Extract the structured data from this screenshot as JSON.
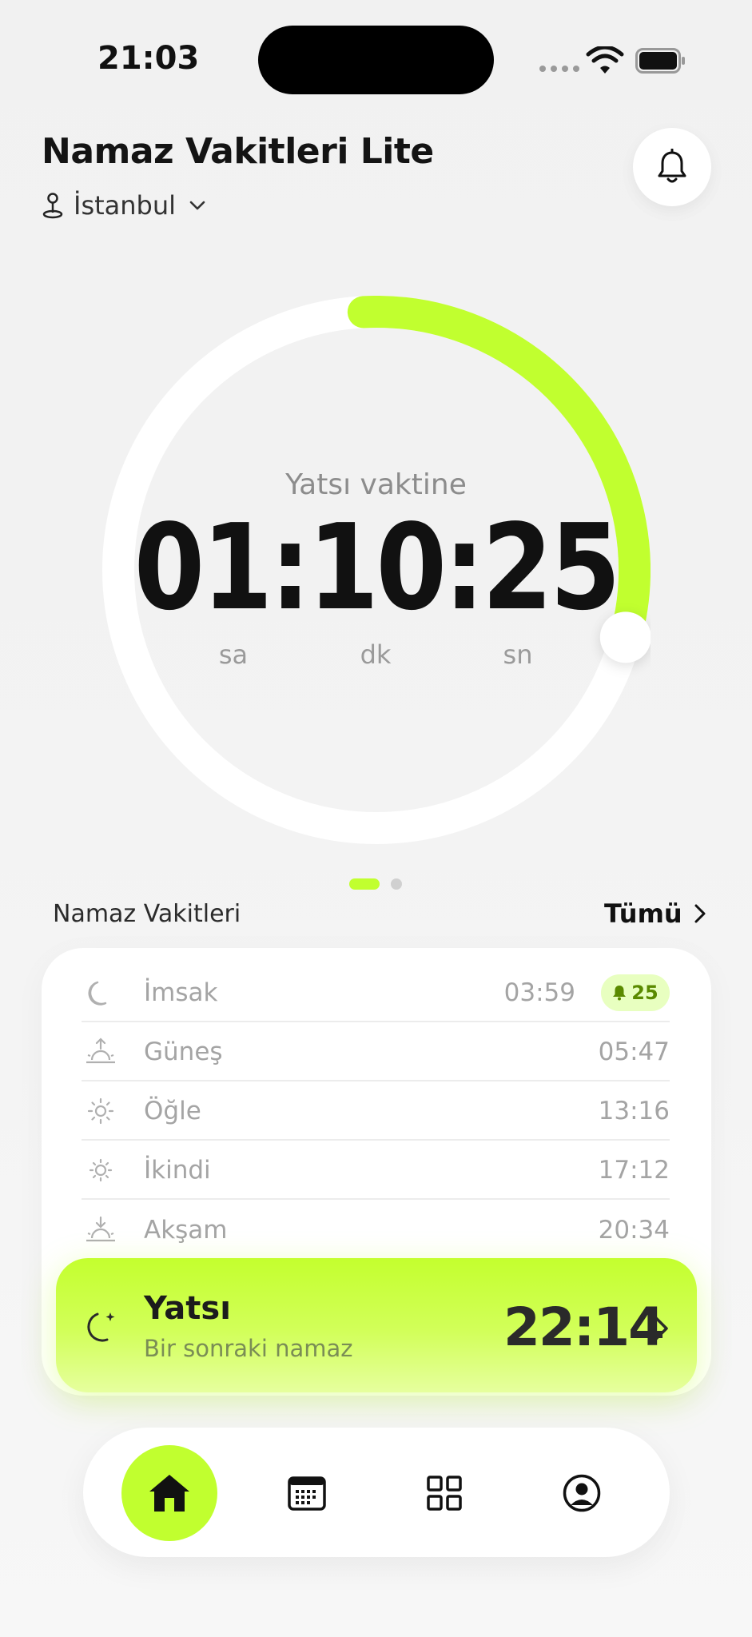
{
  "status": {
    "time": "21:03"
  },
  "header": {
    "title": "Namaz Vakitleri Lite",
    "location": "İstanbul"
  },
  "countdown": {
    "label": "Yatsı vaktine",
    "value": "01:10:25",
    "units": {
      "hours": "sa",
      "minutes": "dk",
      "seconds": "sn"
    },
    "progress": 0.3
  },
  "section": {
    "title": "Namaz Vakitleri",
    "see_all": "Tümü"
  },
  "prayers": [
    {
      "name": "İmsak",
      "time": "03:59",
      "icon": "moon-icon",
      "alarm": "25"
    },
    {
      "name": "Güneş",
      "time": "05:47",
      "icon": "sunrise-icon"
    },
    {
      "name": "Öğle",
      "time": "13:16",
      "icon": "sun-icon"
    },
    {
      "name": "İkindi",
      "time": "17:12",
      "icon": "sun-small-icon"
    },
    {
      "name": "Akşam",
      "time": "20:34",
      "icon": "sunset-icon"
    }
  ],
  "next_prayer": {
    "name": "Yatsı",
    "subtitle": "Bir sonraki namaz",
    "time": "22:14",
    "icon": "moon-stars-icon"
  },
  "nav": {
    "items": [
      "home-icon",
      "calendar-icon",
      "grid-icon",
      "profile-icon"
    ],
    "active": "home-icon"
  },
  "colors": {
    "accent": "#c1ff2f",
    "text": "#111111",
    "muted": "#a4a4a4"
  }
}
